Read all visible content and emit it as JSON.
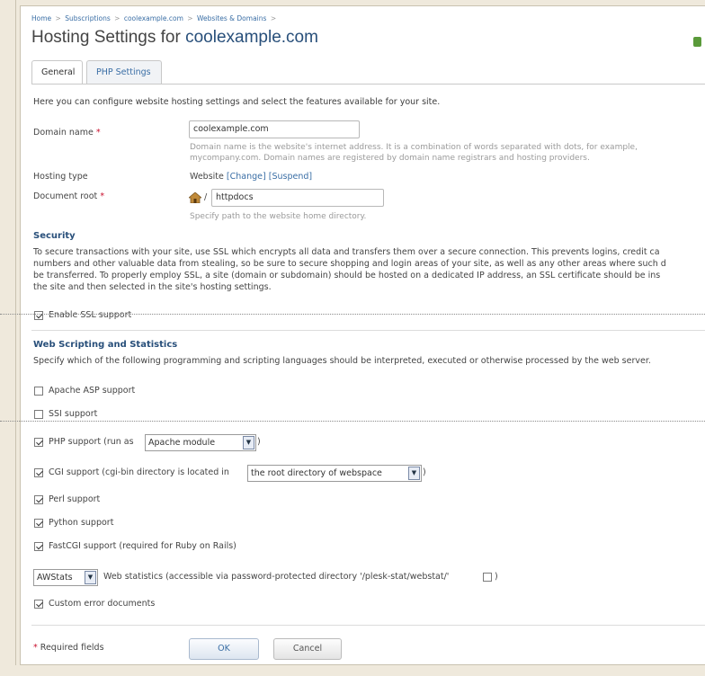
{
  "breadcrumb": [
    "Home",
    "Subscriptions",
    "coolexample.com",
    "Websites & Domains"
  ],
  "breadcrumb_sep": ">",
  "title": {
    "prefix": "Hosting Settings for",
    "domain": "coolexample.com"
  },
  "tabs": [
    {
      "label": "General",
      "active": true
    },
    {
      "label": "PHP Settings",
      "active": false
    }
  ],
  "intro": "Here you can configure website hosting settings and select the features available for your site.",
  "required_mark": "*",
  "domain_name": {
    "label": "Domain name",
    "value": "coolexample.com",
    "hint_line1": "Domain name is the website's internet address. It is a combination of words separated with dots, for example,",
    "hint_line2": "mycompany.com. Domain names are registered by domain name registrars and hosting providers."
  },
  "hosting_type": {
    "label": "Hosting type",
    "value": "Website",
    "change_link": "[Change]",
    "suspend_link": "[Suspend]"
  },
  "document_root": {
    "label": "Document root",
    "slash": "/",
    "value": "httpdocs",
    "hint": "Specify path to the website home directory."
  },
  "security": {
    "heading": "Security",
    "text_lines": [
      "To secure transactions with your site, use SSL which encrypts all data and transfers them over a secure connection. This prevents logins, credit ca",
      "numbers and other valuable data from stealing, so be sure to secure shopping and login areas of your site, as well as any other areas where such d",
      "be transferred. To properly employ SSL, a site (domain or subdomain) should be hosted on a dedicated IP address, an SSL certificate should be ins",
      "the site and then selected in the site's hosting settings."
    ],
    "ssl_label": "Enable SSL support",
    "ssl_checked": true
  },
  "scripting": {
    "heading": "Web Scripting and Statistics",
    "description": "Specify which of the following programming and scripting languages should be interpreted, executed or otherwise processed by the web server.",
    "asp_label": "Apache ASP support",
    "asp_checked": false,
    "ssi_label": "SSI support",
    "ssi_checked": false,
    "php_label": "PHP support (run as",
    "php_checked": true,
    "php_mode": "Apache module",
    "php_close": ")",
    "cgi_label": "CGI support (cgi-bin directory is located in",
    "cgi_checked": true,
    "cgi_location": "the root directory of webspace",
    "cgi_close": ")",
    "perl_label": "Perl support",
    "perl_checked": true,
    "python_label": "Python support",
    "python_checked": true,
    "fastcgi_label": "FastCGI support (required for Ruby on Rails)",
    "fastcgi_checked": true,
    "stats_tool": "AWStats",
    "stats_label": "Web statistics (accessible via password-protected directory '/plesk-stat/webstat/'",
    "stats_close": ")",
    "stats_protected_checked": false,
    "custom_errors_label": "Custom error documents",
    "custom_errors_checked": true
  },
  "footer": {
    "required_note": "Required fields",
    "ok_label": "OK",
    "cancel_label": "Cancel"
  },
  "colors": {
    "link": "#3a6ea5",
    "heading": "#284f7a",
    "required": "#c8102e"
  }
}
